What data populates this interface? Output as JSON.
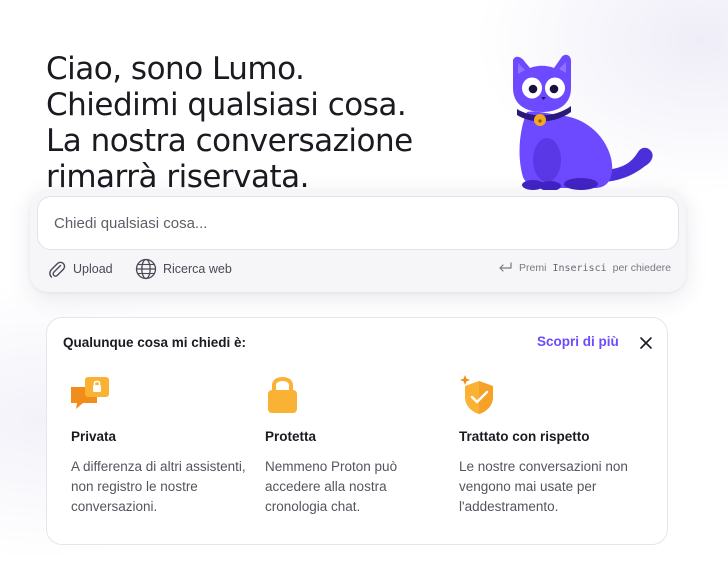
{
  "hero": {
    "line1": "Ciao, sono Lumo.",
    "line2": "Chiedimi qualsiasi cosa.",
    "line3": "La nostra conversazione",
    "line4": "rimarrà riservata."
  },
  "mascot": {
    "icon": "lumo-cat-mascot",
    "color": "#6d4aff"
  },
  "composer": {
    "placeholder": "Chiedi qualsiasi cosa...",
    "upload_label": "Upload",
    "web_search_label": "Ricerca web",
    "hint_prefix": "Premi",
    "hint_key": "Inserisci",
    "hint_suffix": "per chiedere"
  },
  "info_card": {
    "title": "Qualunque cosa mi chiedi è:",
    "learn_more": "Scopri di più",
    "features": [
      {
        "icon": "private-chat-lock-icon",
        "title": "Privata",
        "description": "A differenza di altri assistenti, non registro le nostre conversazioni."
      },
      {
        "icon": "padlock-icon",
        "title": "Protetta",
        "description": "Nemmeno Proton può accedere alla nostra cronologia chat."
      },
      {
        "icon": "shield-check-icon",
        "title": "Trattato con rispetto",
        "description": "Le nostre conversazioni non vengono mai usate per l'addestramento."
      }
    ]
  },
  "colors": {
    "accent": "#6d4aff",
    "feature_icon_orange": "#f5a623",
    "text_primary": "#1b1a21",
    "text_secondary": "#55545e"
  }
}
